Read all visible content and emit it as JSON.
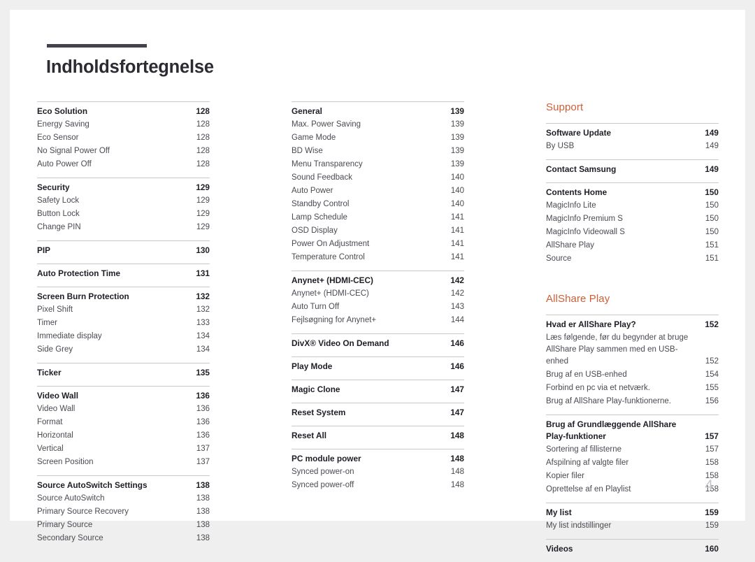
{
  "document": {
    "title": "Indholdsfortegnelse",
    "folio": "4",
    "accent_color": "#cc5f38",
    "rule_color": "#42424e"
  },
  "columns": [
    {
      "name": "column-one",
      "group": null,
      "sections": [
        {
          "heading": {
            "label": "Eco Solution",
            "page": "128"
          },
          "entries": [
            {
              "label": "Energy Saving",
              "page": "128"
            },
            {
              "label": "Eco Sensor",
              "page": "128"
            },
            {
              "label": "No Signal Power Off",
              "page": "128"
            },
            {
              "label": "Auto Power Off",
              "page": "128"
            }
          ]
        },
        {
          "heading": {
            "label": "Security",
            "page": "129"
          },
          "entries": [
            {
              "label": "Safety Lock",
              "page": "129"
            },
            {
              "label": "Button Lock",
              "page": "129"
            },
            {
              "label": "Change PIN",
              "page": "129"
            }
          ]
        },
        {
          "heading": {
            "label": "PIP",
            "page": "130"
          },
          "entries": []
        },
        {
          "heading": {
            "label": "Auto Protection Time",
            "page": "131"
          },
          "entries": []
        },
        {
          "heading": {
            "label": "Screen Burn Protection",
            "page": "132"
          },
          "entries": [
            {
              "label": "Pixel Shift",
              "page": "132"
            },
            {
              "label": "Timer",
              "page": "133"
            },
            {
              "label": "Immediate display",
              "page": "134"
            },
            {
              "label": "Side Grey",
              "page": "134"
            }
          ]
        },
        {
          "heading": {
            "label": "Ticker",
            "page": "135"
          },
          "entries": []
        },
        {
          "heading": {
            "label": "Video Wall",
            "page": "136"
          },
          "entries": [
            {
              "label": "Video Wall",
              "page": "136"
            },
            {
              "label": "Format",
              "page": "136"
            },
            {
              "label": "Horizontal",
              "page": "136"
            },
            {
              "label": "Vertical",
              "page": "137"
            },
            {
              "label": "Screen Position",
              "page": "137"
            }
          ]
        },
        {
          "heading": {
            "label": "Source AutoSwitch Settings",
            "page": "138"
          },
          "entries": [
            {
              "label": "Source AutoSwitch",
              "page": "138"
            },
            {
              "label": "Primary Source Recovery",
              "page": "138"
            },
            {
              "label": "Primary Source",
              "page": "138"
            },
            {
              "label": "Secondary Source",
              "page": "138"
            }
          ]
        }
      ]
    },
    {
      "name": "column-two",
      "group": null,
      "sections": [
        {
          "heading": {
            "label": "General",
            "page": "139"
          },
          "entries": [
            {
              "label": "Max. Power Saving",
              "page": "139"
            },
            {
              "label": "Game Mode",
              "page": "139"
            },
            {
              "label": "BD Wise",
              "page": "139"
            },
            {
              "label": "Menu Transparency",
              "page": "139"
            },
            {
              "label": "Sound Feedback",
              "page": "140"
            },
            {
              "label": "Auto Power",
              "page": "140"
            },
            {
              "label": "Standby Control",
              "page": "140"
            },
            {
              "label": "Lamp Schedule",
              "page": "141"
            },
            {
              "label": "OSD Display",
              "page": "141"
            },
            {
              "label": "Power On Adjustment",
              "page": "141"
            },
            {
              "label": "Temperature Control",
              "page": "141"
            }
          ]
        },
        {
          "heading": {
            "label": "Anynet+ (HDMI-CEC)",
            "page": "142"
          },
          "entries": [
            {
              "label": "Anynet+ (HDMI-CEC)",
              "page": "142"
            },
            {
              "label": "Auto Turn Off",
              "page": "143"
            },
            {
              "label": "Fejlsøgning for Anynet+",
              "page": "144"
            }
          ]
        },
        {
          "heading": {
            "label": "DivX® Video On Demand",
            "page": "146"
          },
          "entries": []
        },
        {
          "heading": {
            "label": "Play Mode",
            "page": "146"
          },
          "entries": []
        },
        {
          "heading": {
            "label": "Magic Clone",
            "page": "147"
          },
          "entries": []
        },
        {
          "heading": {
            "label": "Reset System",
            "page": "147"
          },
          "entries": []
        },
        {
          "heading": {
            "label": "Reset All",
            "page": "148"
          },
          "entries": []
        },
        {
          "heading": {
            "label": "PC module power",
            "page": "148"
          },
          "entries": [
            {
              "label": "Synced power-on",
              "page": "148"
            },
            {
              "label": "Synced power-off",
              "page": "148"
            }
          ]
        }
      ]
    },
    {
      "name": "column-three",
      "group": "Support",
      "sections": [
        {
          "heading": {
            "label": "Software Update",
            "page": "149"
          },
          "entries": [
            {
              "label": "By USB",
              "page": "149"
            }
          ]
        },
        {
          "heading": {
            "label": "Contact Samsung",
            "page": "149"
          },
          "entries": []
        },
        {
          "heading": {
            "label": "Contents Home",
            "page": "150"
          },
          "entries": [
            {
              "label": "MagicInfo Lite",
              "page": "150"
            },
            {
              "label": "MagicInfo Premium S",
              "page": "150"
            },
            {
              "label": "MagicInfo Videowall S",
              "page": "150"
            },
            {
              "label": "AllShare Play",
              "page": "151"
            },
            {
              "label": "Source",
              "page": "151"
            }
          ]
        }
      ],
      "group2": "AllShare Play",
      "sections2": [
        {
          "heading": {
            "label": "Hvad er AllShare Play?",
            "page": "152"
          },
          "entries": [
            {
              "label": "Læs følgende, før du begynder at bruge AllShare Play sammen med en USB-enhed",
              "page": "152",
              "wrap": true
            },
            {
              "label": "Brug af en USB-enhed",
              "page": "154"
            },
            {
              "label": "Forbind en pc via et netværk.",
              "page": "155"
            },
            {
              "label": "Brug af AllShare Play-funktionerne.",
              "page": "156"
            }
          ]
        },
        {
          "heading": {
            "label": "Brug af Grundlæggende AllShare Play-funktioner",
            "page": "157",
            "wrap": true
          },
          "entries": [
            {
              "label": "Sortering af fillisterne",
              "page": "157"
            },
            {
              "label": "Afspilning af valgte filer",
              "page": "158"
            },
            {
              "label": "Kopier filer",
              "page": "158"
            },
            {
              "label": "Oprettelse af en Playlist",
              "page": "158"
            }
          ]
        },
        {
          "heading": {
            "label": "My list",
            "page": "159"
          },
          "entries": [
            {
              "label": "My list indstillinger",
              "page": "159"
            }
          ]
        },
        {
          "heading": {
            "label": "Videos",
            "page": "160"
          },
          "entries": []
        }
      ]
    }
  ]
}
